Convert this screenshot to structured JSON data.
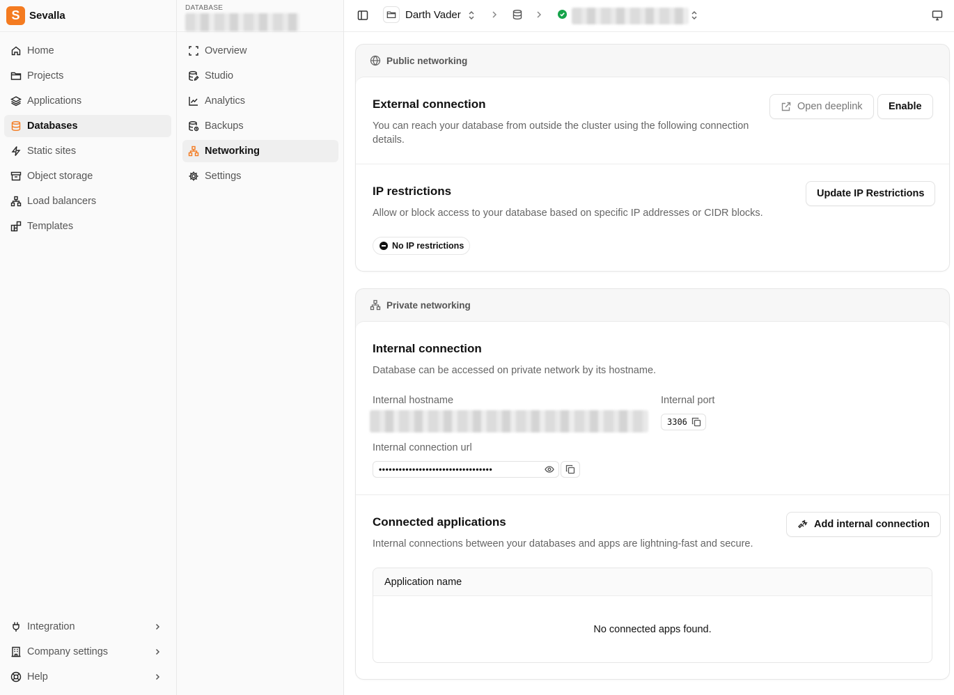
{
  "app": {
    "name": "Sevalla",
    "logo_letter": "S",
    "brand_color": "#f47b20"
  },
  "sidebar": {
    "items": [
      {
        "label": "Home",
        "icon": "home-icon"
      },
      {
        "label": "Projects",
        "icon": "folder-icon"
      },
      {
        "label": "Applications",
        "icon": "layers-icon"
      },
      {
        "label": "Databases",
        "icon": "database-icon",
        "active": true
      },
      {
        "label": "Static sites",
        "icon": "bolt-icon"
      },
      {
        "label": "Object storage",
        "icon": "archive-icon"
      },
      {
        "label": "Load balancers",
        "icon": "network-icon"
      },
      {
        "label": "Templates",
        "icon": "blocks-icon"
      }
    ],
    "bottom": [
      {
        "label": "Integration",
        "icon": "plug-icon"
      },
      {
        "label": "Company settings",
        "icon": "building-icon"
      },
      {
        "label": "Help",
        "icon": "lifebuoy-icon"
      }
    ]
  },
  "database_nav": {
    "kicker": "DATABASE",
    "items": [
      {
        "label": "Overview",
        "icon": "scan-icon"
      },
      {
        "label": "Studio",
        "icon": "database-edit-icon"
      },
      {
        "label": "Analytics",
        "icon": "chart-line-icon"
      },
      {
        "label": "Backups",
        "icon": "database-backup-icon"
      },
      {
        "label": "Networking",
        "icon": "network-icon",
        "active": true
      },
      {
        "label": "Settings",
        "icon": "gear-icon"
      }
    ]
  },
  "topbar": {
    "project": "Darth Vader",
    "status_color": "#16a34a"
  },
  "public_networking": {
    "header": "Public networking",
    "external": {
      "title": "External connection",
      "description": "You can reach your database from outside the cluster using the following connection details.",
      "open_deeplink": "Open deeplink",
      "enable": "Enable"
    },
    "ip": {
      "title": "IP restrictions",
      "description": "Allow or block access to your database based on specific IP addresses or CIDR blocks.",
      "update_button": "Update IP Restrictions",
      "badge": "No IP restrictions"
    }
  },
  "private_networking": {
    "header": "Private networking",
    "internal": {
      "title": "Internal connection",
      "description": "Database can be accessed on private network by its hostname.",
      "hostname_label": "Internal hostname",
      "port_label": "Internal port",
      "port_value": "3306",
      "url_label": "Internal connection url",
      "url_masked": "••••••••••••••••••••••••••••••••••"
    },
    "connected": {
      "title": "Connected applications",
      "description": "Internal connections between your databases and apps are lightning-fast and secure.",
      "add_button": "Add internal connection",
      "column_header": "Application name",
      "empty_text": "No connected apps found."
    }
  }
}
